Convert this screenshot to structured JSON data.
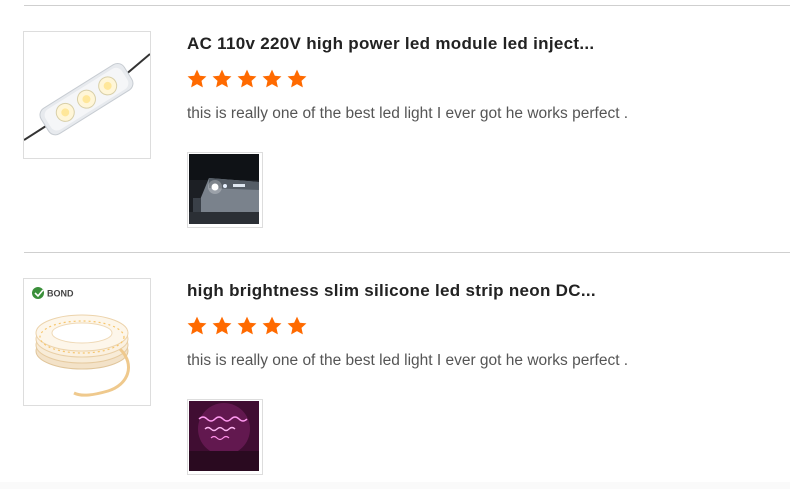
{
  "reviews": [
    {
      "product_title": "AC 110v 220V high power led module led inject...",
      "rating": 5,
      "rating_max": 5,
      "comment": "this is really one of the best led light I ever got he works perfect .",
      "thumbnail_icon": "led-module-product-image",
      "photo_icon": "night-building-photo"
    },
    {
      "product_title": "high brightness slim silicone led strip neon DC...",
      "rating": 5,
      "rating_max": 5,
      "comment": "this is really one of the best led light I ever got he works perfect .",
      "thumbnail_brand": "BOND",
      "thumbnail_icon": "led-strip-reel-product-image",
      "photo_icon": "pink-neon-sign-photo"
    }
  ],
  "colors": {
    "star": "#ff6a00",
    "divider": "#cfcfcf",
    "title": "#222222",
    "comment": "#555555"
  }
}
